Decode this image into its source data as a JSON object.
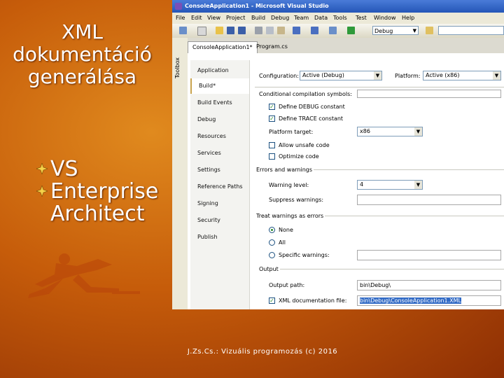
{
  "slide": {
    "title_lines": [
      "XML",
      "dokumentáció",
      "generálása"
    ],
    "bullets": [
      "VS",
      "Enterprise Architect"
    ],
    "footer": "J.Zs.Cs.: Vizuális programozás (c) 2016"
  },
  "window": {
    "title": "ConsoleApplication1 - Microsoft Visual Studio",
    "menu": [
      "File",
      "Edit",
      "View",
      "Project",
      "Build",
      "Debug",
      "Team",
      "Data",
      "Tools",
      "Test",
      "Window",
      "Help"
    ],
    "toolbar_config": "Debug",
    "toolbox_label": "Toolbox",
    "tabs": [
      "ConsoleApplication1*",
      "Program.cs"
    ]
  },
  "nav_items": [
    "Application",
    "Build*",
    "Build Events",
    "Debug",
    "Resources",
    "Services",
    "Settings",
    "Reference Paths",
    "Signing",
    "Security",
    "Publish"
  ],
  "build": {
    "configuration_label": "Configuration:",
    "configuration_value": "Active (Debug)",
    "platform_label": "Platform:",
    "platform_value": "Active (x86)",
    "conditional_symbols_label": "Conditional compilation symbols:",
    "define_debug_label": "Define DEBUG constant",
    "define_trace_label": "Define TRACE constant",
    "platform_target_label": "Platform target:",
    "platform_target_value": "x86",
    "allow_unsafe_label": "Allow unsafe code",
    "optimize_label": "Optimize code",
    "errors_header": "Errors and warnings",
    "warning_level_label": "Warning level:",
    "warning_level_value": "4",
    "suppress_label": "Suppress warnings:",
    "treat_header": "Treat warnings as errors",
    "radio_none": "None",
    "radio_all": "All",
    "radio_specific": "Specific warnings:",
    "output_header": "Output",
    "output_path_label": "Output path:",
    "output_path_value": "bin\\Debug\\",
    "xml_doc_label": "XML documentation file:",
    "xml_doc_value": "bin\\Debug\\ConsoleApplication1.XML"
  },
  "colors": {
    "background": "#c65c0a",
    "titlebar": "#2456b7",
    "selection": "#316ac5"
  }
}
